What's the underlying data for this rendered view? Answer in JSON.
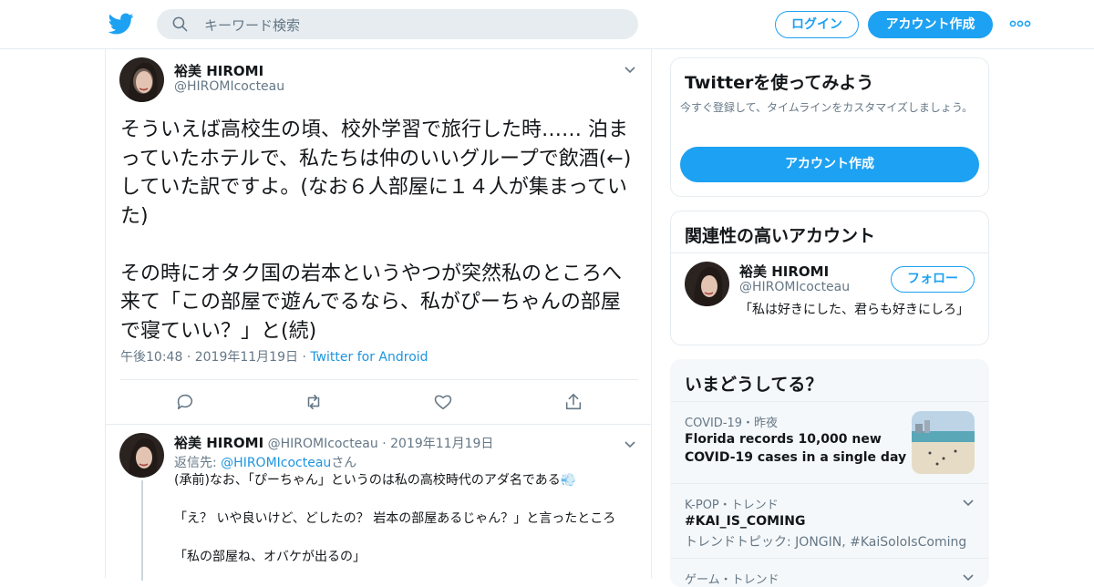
{
  "header": {
    "search_placeholder": "キーワード検索",
    "login_label": "ログイン",
    "signup_label": "アカウント作成"
  },
  "tweet": {
    "author_name": "裕美 HIROMI",
    "author_handle": "@HIROMIcocteau",
    "text": "そういえば高校生の頃、校外学習で旅行した時…… 泊まっていたホテルで、私たちは仲のいいグループで飲酒(←)していた訳ですよ。(なお６人部屋に１４人が集まっていた)\n\nその時にオタク国の岩本というやつが突然私のところへ来て「この部屋で遊んでるなら、私がぴーちゃんの部屋で寝ていい？」と(続)",
    "time": "午後10:48",
    "date": "2019年11月19日",
    "client": "Twitter for Android"
  },
  "reply": {
    "author_name": "裕美 HIROMI",
    "author_handle": "@HIROMIcocteau",
    "date": "2019年11月19日",
    "reply_prefix": "返信先: ",
    "reply_handle": "@HIROMIcocteau",
    "reply_suffix": "さん",
    "text": "(承前)なお、「ぴーちゃん」というのは私の高校時代のアダ名である💨\n\n「え？ いや良いけど、どしたの？ 岩本の部屋あるじゃん？」と言ったところ\n\n「私の部屋ね、オバケが出るの」"
  },
  "sidebar": {
    "try_card": {
      "title": "Twitterを使ってみよう",
      "desc": "今すぐ登録して、タイムラインをカスタマイズしましょう。",
      "button": "アカウント作成"
    },
    "related": {
      "title": "関連性の高いアカウント",
      "name": "裕美 HIROMI",
      "handle": "@HIROMIcocteau",
      "bio": "「私は好きにした、君らも好きにしろ」",
      "follow_label": "フォロー"
    },
    "trends": {
      "title": "いまどうしてる？",
      "items": [
        {
          "context": "COVID-19・昨夜",
          "title": "Florida records 10,000 new COVID-19 cases in a single day"
        },
        {
          "context": "K-POP・トレンド",
          "title": "#KAI_IS_COMING",
          "sub": "トレンドトピック: JONGIN, #KaiSoloIsComing"
        },
        {
          "context": "ゲーム・トレンド"
        }
      ]
    }
  },
  "colors": {
    "brand": "#1da1f2",
    "link": "#1b95e0",
    "muted": "#657786"
  }
}
